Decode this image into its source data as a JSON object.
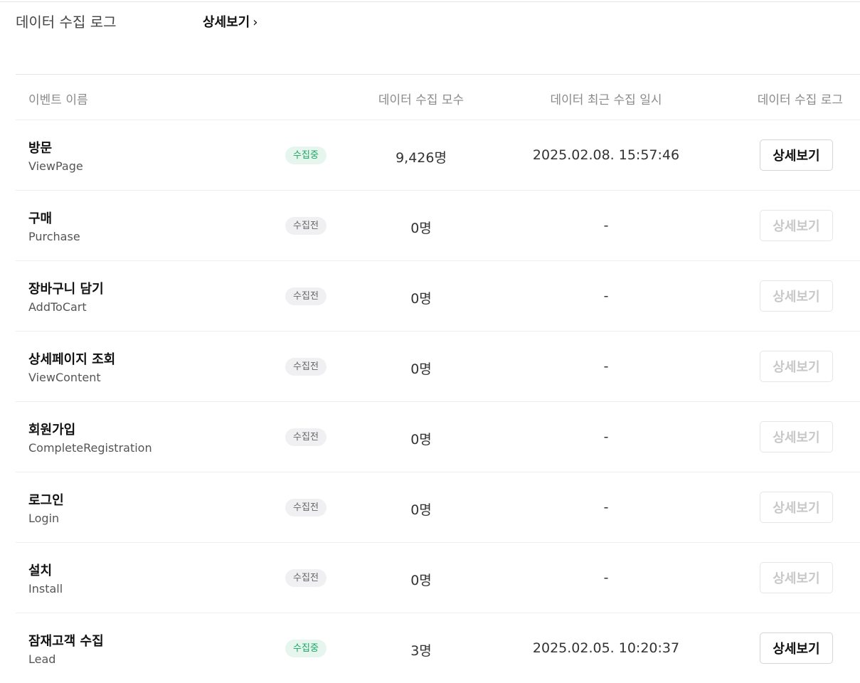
{
  "header": {
    "title": "데이터 수집 로그",
    "detail_link": "상세보기",
    "chevron": "›"
  },
  "table": {
    "columns": [
      "이벤트 이름",
      "데이터 수집 모수",
      "데이터 최근 수집 일시",
      "데이터 수집 로그"
    ],
    "rows": [
      {
        "name": "방문",
        "code": "ViewPage",
        "status": "수집중",
        "active": true,
        "count": "9,426명",
        "last": "2025.02.08. 15:57:46",
        "action": "상세보기"
      },
      {
        "name": "구매",
        "code": "Purchase",
        "status": "수집전",
        "active": false,
        "count": "0명",
        "last": "-",
        "action": "상세보기"
      },
      {
        "name": "장바구니 담기",
        "code": "AddToCart",
        "status": "수집전",
        "active": false,
        "count": "0명",
        "last": "-",
        "action": "상세보기"
      },
      {
        "name": "상세페이지 조회",
        "code": "ViewContent",
        "status": "수집전",
        "active": false,
        "count": "0명",
        "last": "-",
        "action": "상세보기"
      },
      {
        "name": "회원가입",
        "code": "CompleteRegistration",
        "status": "수집전",
        "active": false,
        "count": "0명",
        "last": "-",
        "action": "상세보기"
      },
      {
        "name": "로그인",
        "code": "Login",
        "status": "수집전",
        "active": false,
        "count": "0명",
        "last": "-",
        "action": "상세보기"
      },
      {
        "name": "설치",
        "code": "Install",
        "status": "수집전",
        "active": false,
        "count": "0명",
        "last": "-",
        "action": "상세보기"
      },
      {
        "name": "잠재고객 수집",
        "code": "Lead",
        "status": "수집중",
        "active": true,
        "count": "3명",
        "last": "2025.02.05. 10:20:37",
        "action": "상세보기"
      }
    ]
  },
  "colors": {
    "active_badge_text": "#1aa564",
    "active_badge_bg": "#e6f6ee",
    "idle_badge_bg": "#f0f0f2"
  }
}
